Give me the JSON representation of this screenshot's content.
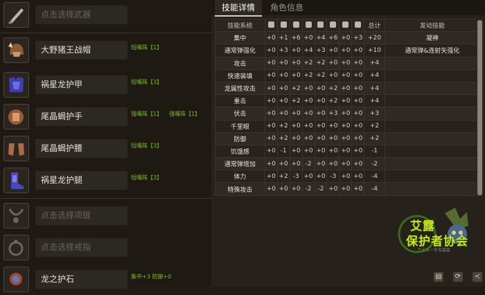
{
  "left": {
    "rows": [
      {
        "label": "点击选择武器",
        "icon": "sword-icon",
        "empty": true,
        "deco": []
      },
      {
        "label": "大野猪王战帽",
        "icon": "helmet-icon",
        "empty": false,
        "deco": [
          "短嘴珠【1】"
        ]
      },
      {
        "label": "祸星龙护甲",
        "icon": "chest-armor-icon",
        "empty": false,
        "deco": [
          "短嘴珠【3】"
        ]
      },
      {
        "label": "尾晶蝎护手",
        "icon": "gauntlet-icon",
        "empty": false,
        "deco": [
          "强嘴珠【1】",
          "强嘴珠【1】"
        ]
      },
      {
        "label": "尾晶蝎护腰",
        "icon": "waist-icon",
        "empty": false,
        "deco": [
          "短嘴珠【3】"
        ]
      },
      {
        "label": "祸星龙护腿",
        "icon": "greaves-icon",
        "empty": false,
        "deco": [
          "短嘴珠【3】"
        ]
      },
      {
        "label": "点击选择项链",
        "icon": "necklace-icon",
        "empty": true,
        "deco": []
      },
      {
        "label": "点击选择戒指",
        "icon": "ring-icon",
        "empty": true,
        "deco": []
      },
      {
        "label": "龙之护石",
        "icon": "charm-icon",
        "empty": false,
        "deco": [
          "集中+3 防御+0"
        ]
      }
    ]
  },
  "tabs": [
    "技能详情",
    "角色信息"
  ],
  "table": {
    "headers": [
      "技能系统",
      "sword-icon",
      "helmet-icon",
      "chest-icon",
      "arm-icon",
      "waist-icon",
      "leg-icon",
      "necklace-icon",
      "charm-icon",
      "总计",
      "发动技能"
    ],
    "rows": [
      [
        "集中",
        "+0",
        "+1",
        "+6",
        "+0",
        "+4",
        "+6",
        "+0",
        "+3",
        "+20",
        "凝神"
      ],
      [
        "通常弹强化",
        "+0",
        "+3",
        "+0",
        "+4",
        "+3",
        "+0",
        "+0",
        "+0",
        "+10",
        "通常弹&连射矢强化"
      ],
      [
        "攻击",
        "+0",
        "+0",
        "+0",
        "+2",
        "+2",
        "+0",
        "+0",
        "+0",
        "+4",
        ""
      ],
      [
        "快速装填",
        "+0",
        "+0",
        "+0",
        "+2",
        "+2",
        "+0",
        "+0",
        "+0",
        "+4",
        ""
      ],
      [
        "龙属性攻击",
        "+0",
        "+0",
        "+2",
        "+0",
        "+0",
        "+2",
        "+0",
        "+0",
        "+4",
        ""
      ],
      [
        "重击",
        "+0",
        "+0",
        "+2",
        "+0",
        "+0",
        "+2",
        "+0",
        "+0",
        "+4",
        ""
      ],
      [
        "伏击",
        "+0",
        "+0",
        "+0",
        "+0",
        "+0",
        "+3",
        "+0",
        "+0",
        "+3",
        ""
      ],
      [
        "千里眼",
        "+0",
        "+2",
        "+0",
        "+0",
        "+0",
        "+0",
        "+0",
        "+0",
        "+2",
        ""
      ],
      [
        "防御",
        "+0",
        "+2",
        "+0",
        "+0",
        "+0",
        "+0",
        "+0",
        "+0",
        "+2",
        ""
      ],
      [
        "饥饿感",
        "+0",
        "-1",
        "+0",
        "+0",
        "+0",
        "+0",
        "+0",
        "+0",
        "-1",
        ""
      ],
      [
        "通常弹增加",
        "+0",
        "+0",
        "+0",
        "-2",
        "+0",
        "+0",
        "+0",
        "+0",
        "-2",
        ""
      ],
      [
        "体力",
        "+0",
        "+2",
        "-3",
        "+0",
        "+0",
        "-3",
        "+0",
        "+0",
        "-4",
        ""
      ],
      [
        "特殊攻击",
        "+0",
        "+0",
        "+0",
        "-2",
        "-2",
        "+0",
        "+0",
        "+0",
        "-4",
        ""
      ]
    ]
  },
  "logo": {
    "line1": "艾露",
    "line2": "保护者协会",
    "line3": "アイルー守る協会"
  },
  "buttons": [
    {
      "name": "save-icon",
      "glyph": "▤"
    },
    {
      "name": "refresh-icon",
      "glyph": "⟳"
    },
    {
      "name": "share-icon",
      "glyph": "≺"
    }
  ],
  "colors": {
    "accent_green": "#7bbd2a",
    "logo_green": "#c9e12a",
    "text": "#e6e0d6"
  }
}
